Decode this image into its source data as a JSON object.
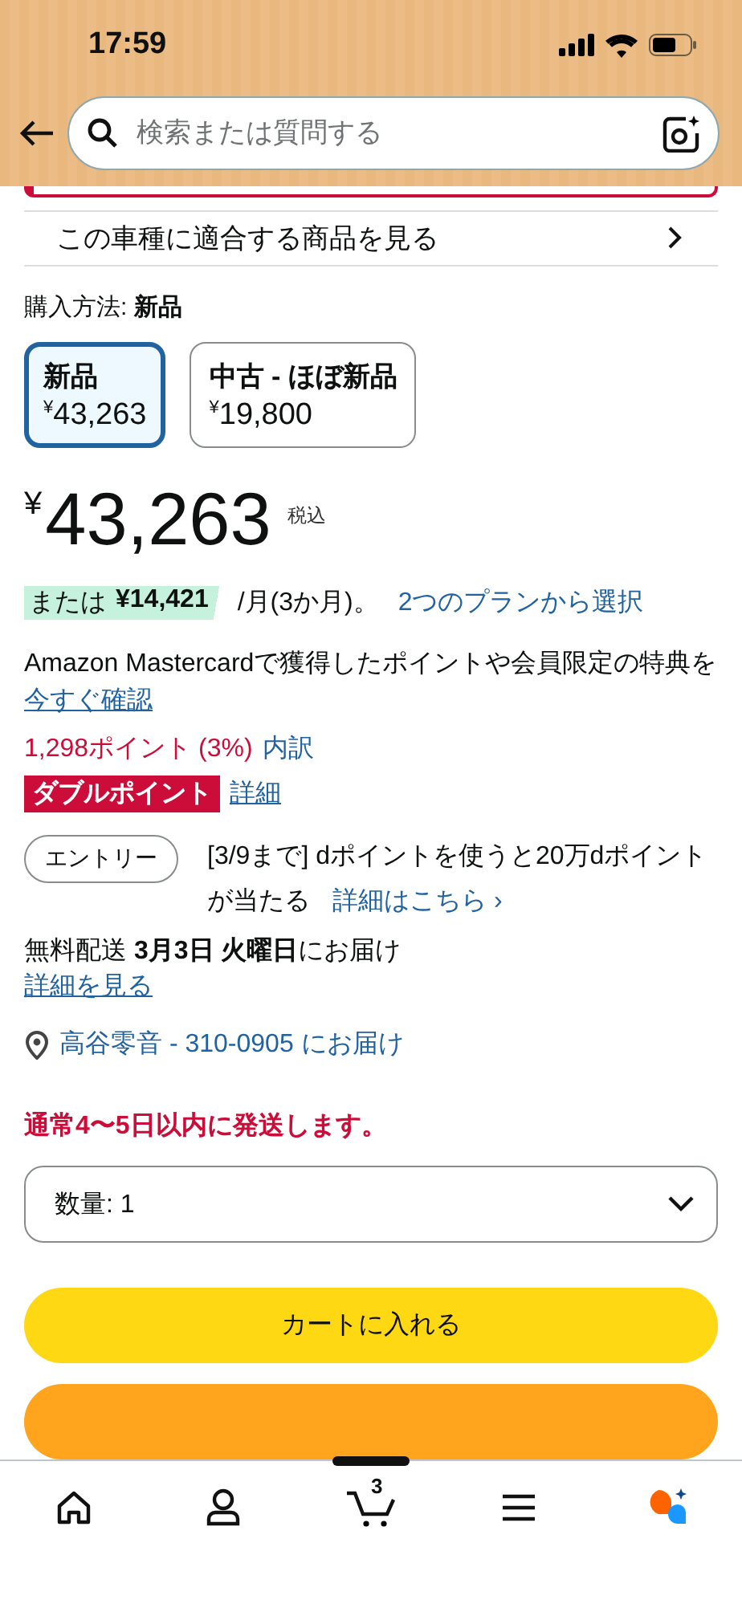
{
  "status_bar": {
    "time": "17:59"
  },
  "search": {
    "placeholder": "検索または質問する"
  },
  "fitment_link": {
    "label": "この車種に適合する商品を見る"
  },
  "purchase_method": {
    "label": "購入方法:",
    "value": "新品"
  },
  "options": [
    {
      "name": "新品",
      "currency": "¥",
      "price": "43,263",
      "selected": true
    },
    {
      "name": "中古 - ほぼ新品",
      "currency": "¥",
      "price": "19,800",
      "selected": false
    }
  ],
  "price": {
    "currency": "¥",
    "amount": "43,263",
    "tax_note": "税込"
  },
  "installment": {
    "prefix": "または",
    "amount": "¥14,421",
    "suffix": "/月(3か月)。",
    "link": "2つのプランから選択"
  },
  "card_promo": {
    "text": "Amazon Mastercardで獲得したポイントや会員限定の特典を",
    "link": "今すぐ確認"
  },
  "points": {
    "text": "1,298ポイント (3%)",
    "link": "内訳"
  },
  "double_point": {
    "badge": "ダブルポイント",
    "link": "詳細"
  },
  "entry": {
    "button": "エントリー",
    "text": "[3/9まで] dポイントを使うと20万dポイントが当たる",
    "link": "詳細はこちら ›"
  },
  "delivery": {
    "text": "無料配送 **3月3日 火曜日**にお届け",
    "link": "詳細を見る"
  },
  "address": {
    "text": "高谷零音 - 310-0905 にお届け"
  },
  "stock_notice": "通常4〜5日以内に発送します。",
  "quantity": {
    "label": "数量: 1"
  },
  "buttons": [
    {
      "kind": "cart",
      "label": "カートに入れる"
    },
    {
      "kind": "buy"
    }
  ],
  "bottom_nav": {
    "cart_count": "3"
  }
}
